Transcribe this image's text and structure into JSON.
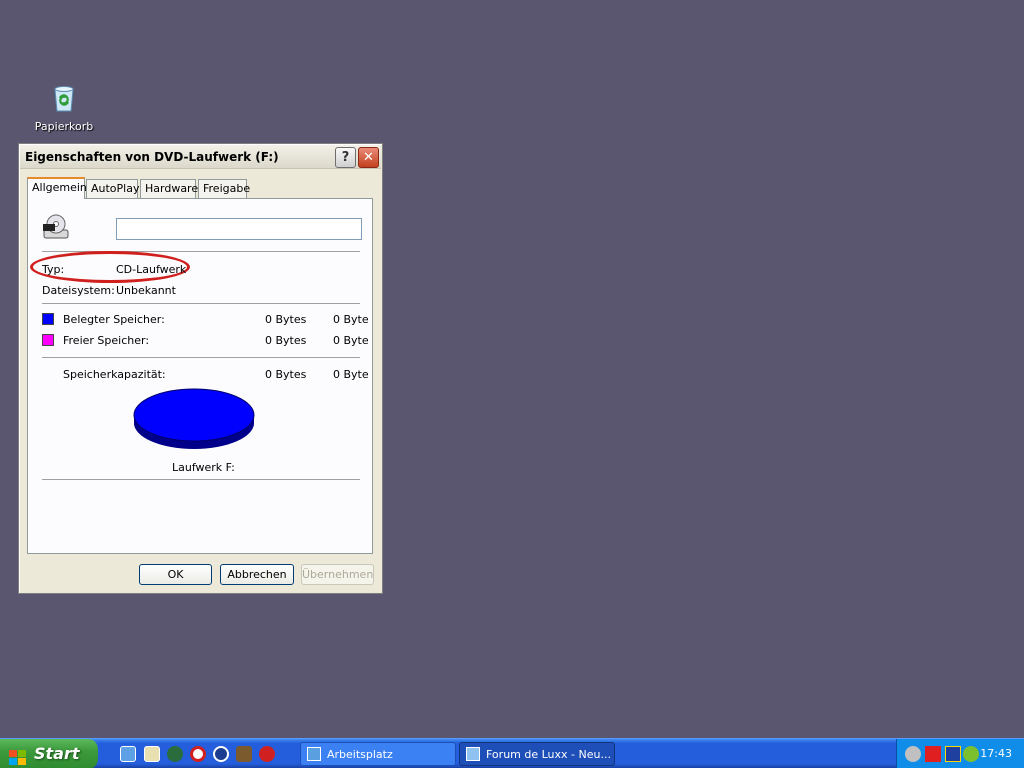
{
  "desktop": {
    "recycle_bin_label": "Papierkorb"
  },
  "dialog": {
    "title": "Eigenschaften von DVD-Laufwerk (F:)",
    "help_label": "?",
    "close_label": "✕",
    "tabs": [
      {
        "label": "Allgemein"
      },
      {
        "label": "AutoPlay"
      },
      {
        "label": "Hardware"
      },
      {
        "label": "Freigabe"
      }
    ],
    "name_value": "",
    "type_label": "Typ:",
    "type_value": "CD-Laufwerk",
    "fs_label": "Dateisystem:",
    "fs_value": "Unbekannt",
    "used_label": "Belegter Speicher:",
    "used_bytes": "0 Bytes",
    "used_short": "0 Byte",
    "free_label": "Freier Speicher:",
    "free_bytes": "0 Bytes",
    "free_short": "0 Byte",
    "capacity_label": "Speicherkapazität:",
    "capacity_bytes": "0 Bytes",
    "capacity_short": "0 Byte",
    "drive_label": "Laufwerk F:",
    "ok_label": "OK",
    "cancel_label": "Abbrechen",
    "apply_label": "Übernehmen",
    "colors": {
      "used": "#0000ff",
      "free": "#ff00ff",
      "annotation": "#d0201e"
    }
  },
  "taskbar": {
    "start_label": "Start",
    "tasks": [
      {
        "label": "Arbeitsplatz"
      },
      {
        "label": "Forum de Luxx - Neu..."
      }
    ],
    "clock": "17:43"
  }
}
